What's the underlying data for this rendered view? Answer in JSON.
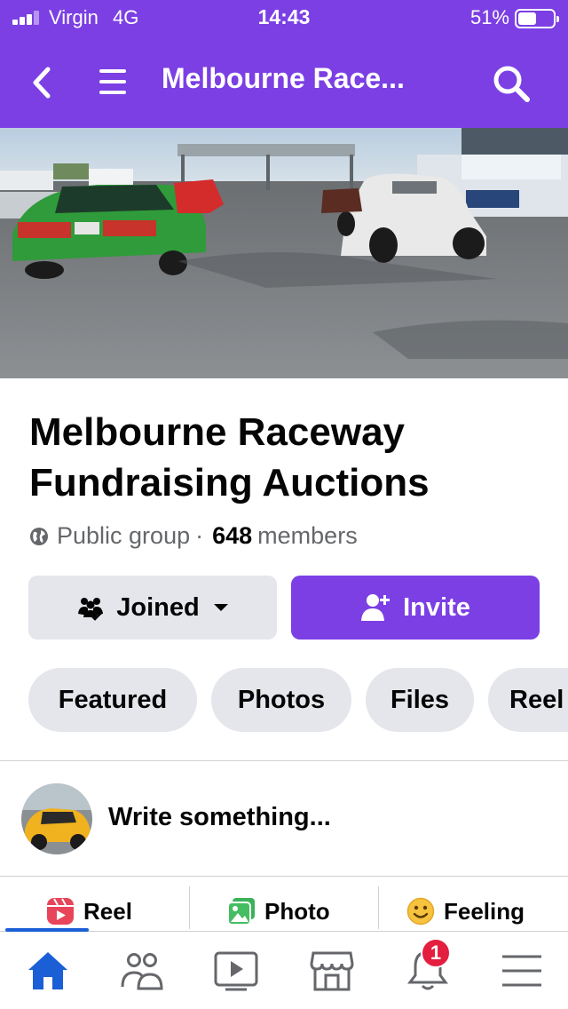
{
  "status_bar": {
    "carrier": "Virgin",
    "network": "4G",
    "time": "14:43",
    "battery_percent": "51%",
    "battery_level": 0.51
  },
  "header": {
    "title": "Melbourne Race...",
    "back_icon": "chevron-left-icon",
    "menu_icon": "hamburger-icon",
    "search_icon": "search-icon"
  },
  "group": {
    "name": "Melbourne Raceway Fundraising Auctions",
    "privacy": "Public group",
    "separator": "·",
    "member_count": "648",
    "members_label": "members"
  },
  "actions": {
    "joined_label": "Joined",
    "invite_label": "Invite"
  },
  "tabs": [
    {
      "label": "Featured"
    },
    {
      "label": "Photos"
    },
    {
      "label": "Files"
    },
    {
      "label": "Reel"
    }
  ],
  "composer": {
    "placeholder": "Write something...",
    "actions": [
      {
        "label": "Reel",
        "icon": "reel-icon"
      },
      {
        "label": "Photo",
        "icon": "photo-icon"
      },
      {
        "label": "Feeling",
        "icon": "smiley-icon"
      }
    ]
  },
  "bottom_nav": {
    "items": [
      {
        "icon": "home-icon"
      },
      {
        "icon": "groups-icon"
      },
      {
        "icon": "video-icon"
      },
      {
        "icon": "marketplace-icon"
      },
      {
        "icon": "bell-icon"
      },
      {
        "icon": "menu-icon"
      }
    ],
    "notification_badge": "1"
  },
  "colors": {
    "brand_purple": "#7b3fe4",
    "active_blue": "#1a5fd6",
    "badge_red": "#e41e3f",
    "button_gray": "#e4e6eb"
  }
}
